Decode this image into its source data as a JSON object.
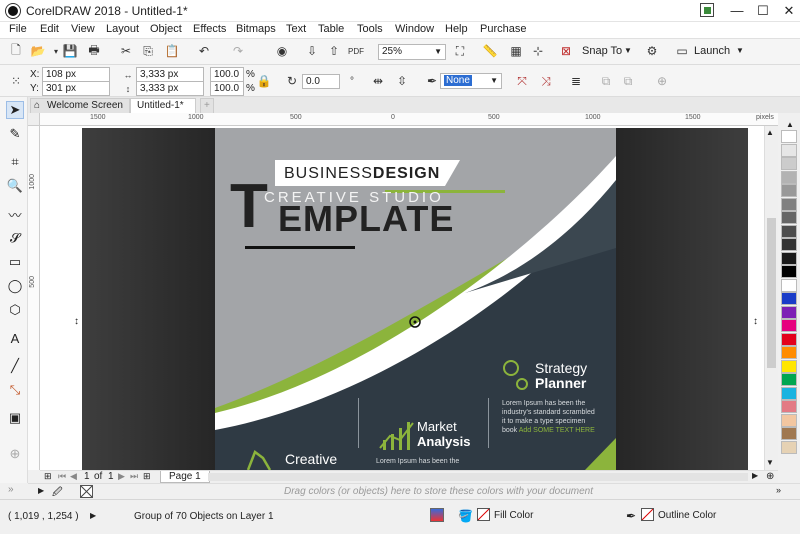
{
  "window": {
    "title": "CorelDRAW 2018 - Untitled-1*",
    "min": "—",
    "max": "☐",
    "close": "✕"
  },
  "menu": [
    "File",
    "Edit",
    "View",
    "Layout",
    "Object",
    "Effects",
    "Bitmaps",
    "Text",
    "Table",
    "Tools",
    "Window",
    "Help",
    "Purchase"
  ],
  "std_toolbar": {
    "zoom": "25%",
    "snap_to": "Snap To",
    "launch": "Launch"
  },
  "prop_bar": {
    "x": "108 px",
    "y": "301 px",
    "w": "3,333 px",
    "h": "3,333 px",
    "scale_x": "100.0",
    "scale_y": "100.0",
    "pct": "%",
    "angle": "0.0",
    "outline": "None",
    "x_label": "X:",
    "y_label": "Y:"
  },
  "tabs": {
    "welcome": "Welcome Screen",
    "doc": "Untitled-1*",
    "add": "+"
  },
  "ruler": {
    "unit": "pixels",
    "h_ticks": [
      "1500",
      "1000",
      "500",
      "0",
      "500",
      "1000",
      "1500"
    ],
    "v_ticks": [
      "1000",
      "500"
    ]
  },
  "design": {
    "business": "BUSINESS",
    "design": "DESIGN",
    "creative_studio": "CREATIVE STUDIO",
    "template_t": "T",
    "template_rest": "EMPLATE",
    "strategy": "Strategy",
    "planner": "Planner",
    "strategy_body_1": "Lorem Ipsum has been the",
    "strategy_body_2": "industry's standard scrambled",
    "strategy_body_3": "it to make a type specimen",
    "strategy_body_4": "book",
    "strategy_body_link": "Add SOME TEXT HERE",
    "market": "Market",
    "analysis": "Analysis",
    "market_body": "Lorem Ipsum has been the",
    "creative": "Creative"
  },
  "pagebar": {
    "page_of": "1",
    "of": "of",
    "total": "1",
    "page_tab": "Page 1"
  },
  "drop_hint": "Drag colors (or objects) here to store these colors with your document",
  "status": {
    "coords": "( 1,019 , 1,254 )",
    "object_info": "Group of 70 Objects on Layer 1",
    "fill": "Fill Color",
    "outline": "Outline Color"
  },
  "colors": {
    "accent_green": "#8cb43c",
    "dark_slate": "#2f3a44",
    "panel_gray": "#a3a5a8"
  },
  "palette": [
    "#ffffff",
    "#e6e6e6",
    "#cccccc",
    "#b3b3b3",
    "#999999",
    "#808080",
    "#666666",
    "#4d4d4d",
    "#333333",
    "#1a1a1a",
    "#000000",
    "#ffffff",
    "#1a3cc8",
    "#7d1fb5",
    "#e6007e",
    "#e3001b",
    "#ff8c00",
    "#ffe600",
    "#00a651",
    "#19b3e0",
    "#e37a84",
    "#f2c6a0",
    "#a07850",
    "#e6d2b4"
  ]
}
